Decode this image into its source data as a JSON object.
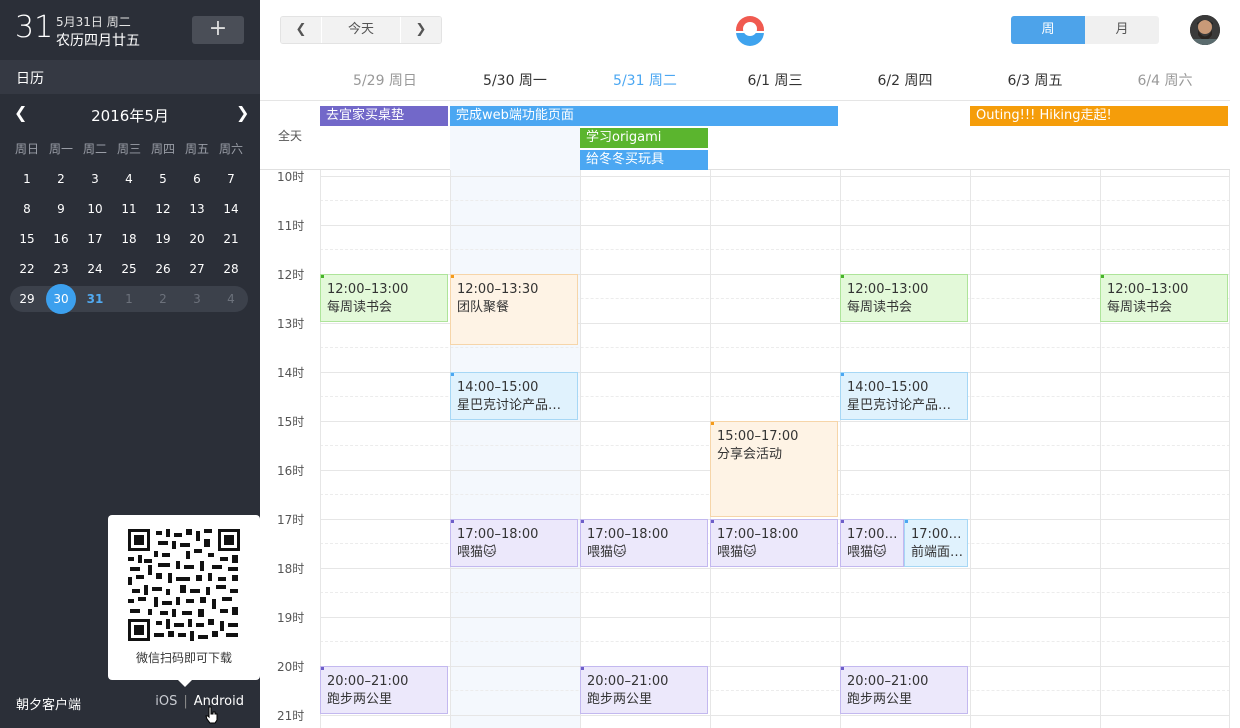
{
  "sidebar": {
    "big_day": "31",
    "date_line1": "5月31日 周二",
    "lunar": "农历四月廿五",
    "add_label": "+",
    "calendar_label": "日历",
    "month_title": "2016年5月",
    "prev_label": "❮",
    "next_label": "❯",
    "weekdays": [
      "周日",
      "周一",
      "周二",
      "周三",
      "周四",
      "周五",
      "周六"
    ],
    "weeks": [
      [
        "1",
        "2",
        "3",
        "4",
        "5",
        "6",
        "7"
      ],
      [
        "8",
        "9",
        "10",
        "11",
        "12",
        "13",
        "14"
      ],
      [
        "15",
        "16",
        "17",
        "18",
        "19",
        "20",
        "21"
      ],
      [
        "22",
        "23",
        "24",
        "25",
        "26",
        "27",
        "28"
      ],
      [
        "29",
        "30",
        "31",
        "1",
        "2",
        "3",
        "4"
      ]
    ],
    "qr_caption": "微信扫码即可下载",
    "client_label": "朝夕客户端",
    "ios_label": "iOS",
    "sep": "|",
    "android_label": "Android"
  },
  "toolbar": {
    "prev": "❮",
    "today": "今天",
    "next": "❯",
    "week_view": "周",
    "month_view": "月"
  },
  "days": [
    "5/29 周日",
    "5/30 周一",
    "5/31 周二",
    "6/1 周三",
    "6/2 周四",
    "6/3 周五",
    "6/4 周六"
  ],
  "allday_label": "全天",
  "allday_events": [
    {
      "title": "去宜家买桌垫",
      "color": "#7268c9"
    },
    {
      "title": "完成web端功能页面",
      "color": "#4ba7f2"
    },
    {
      "title": "学习origami",
      "color": "#5bb52e"
    },
    {
      "title": "给冬冬买玩具",
      "color": "#4ba7f2"
    },
    {
      "title": "Outing!!! Hiking走起!",
      "color": "#f59d0a"
    }
  ],
  "hours": [
    "10时",
    "11时",
    "12时",
    "13时",
    "14时",
    "15时",
    "16时",
    "17时",
    "18时",
    "19时",
    "20时",
    "21时"
  ],
  "events": [
    {
      "time": "12:00–13:00",
      "title": "每周读书会"
    },
    {
      "time": "12:00–13:30",
      "title": "团队聚餐"
    },
    {
      "time": "12:00–13:00",
      "title": "每周读书会"
    },
    {
      "time": "12:00–13:00",
      "title": "每周读书会"
    },
    {
      "time": "14:00–15:00",
      "title": "星巴克讨论产品…"
    },
    {
      "time": "14:00–15:00",
      "title": "星巴克讨论产品…"
    },
    {
      "time": "15:00–17:00",
      "title": "分享会活动"
    },
    {
      "time": "17:00–18:00",
      "title": "喂猫🐱"
    },
    {
      "time": "17:00–18:00",
      "title": "喂猫🐱"
    },
    {
      "time": "17:00–18:00",
      "title": "喂猫🐱"
    },
    {
      "time": "17:00…",
      "title": "喂猫🐱"
    },
    {
      "time": "17:00…",
      "title": "前端面…"
    },
    {
      "time": "20:00–21:00",
      "title": "跑步两公里"
    },
    {
      "time": "20:00–21:00",
      "title": "跑步两公里"
    },
    {
      "time": "20:00–21:00",
      "title": "跑步两公里"
    }
  ]
}
